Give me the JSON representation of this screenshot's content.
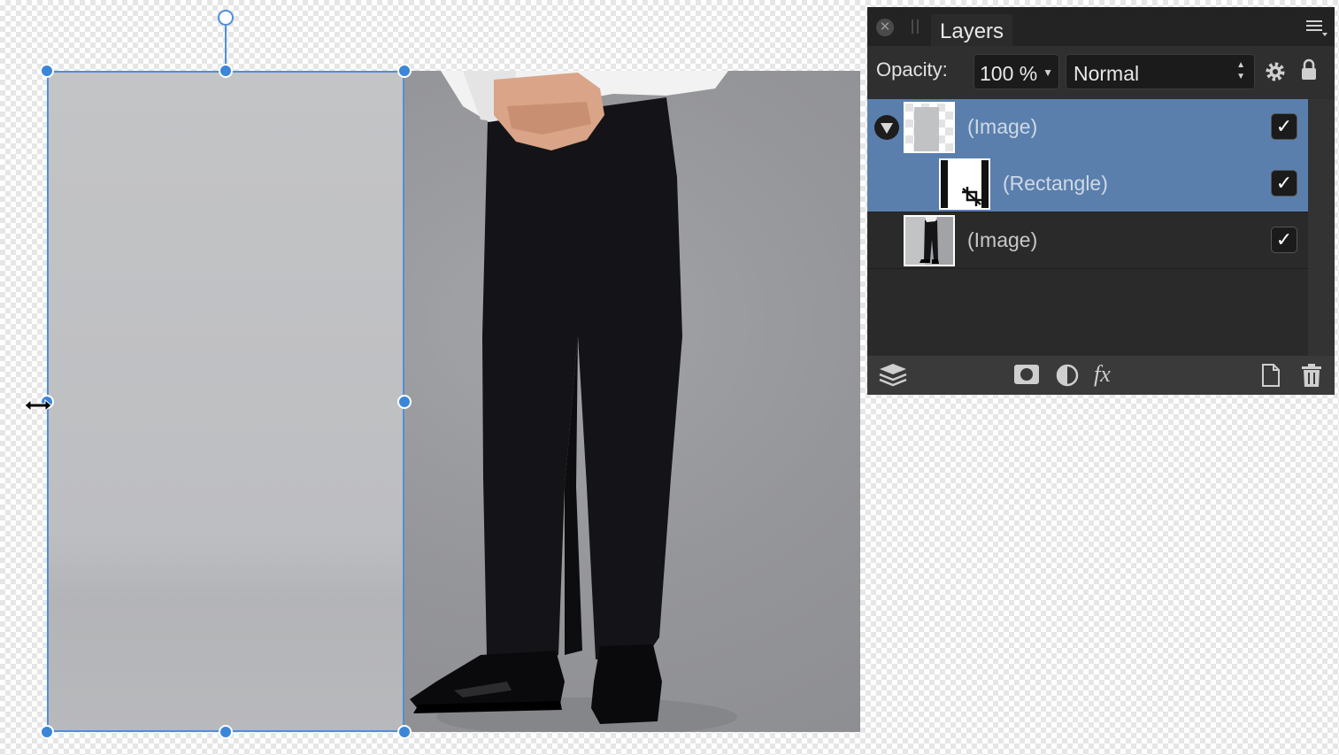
{
  "panel": {
    "title": "Layers",
    "opacity_label": "Opacity:",
    "opacity_value": "100 %",
    "blend_mode": "Normal"
  },
  "layers": [
    {
      "name": "(Image)",
      "selected": true,
      "visible": true
    },
    {
      "name": "(Rectangle)",
      "selected": true,
      "visible": true,
      "child": true
    },
    {
      "name": "(Image)",
      "selected": false,
      "visible": true
    }
  ],
  "icons": {
    "close": "close-icon",
    "menu": "panel-menu-icon",
    "settings": "gear-icon",
    "lock": "lock-icon",
    "layers": "layers-stack-icon",
    "mask": "mask-icon",
    "adjustment": "adjustment-icon",
    "fx": "fx",
    "new": "new-layer-icon",
    "delete": "trash-icon"
  },
  "colors": {
    "selection": "#4f8fd8",
    "selected_row": "#5a7fad",
    "panel_bg": "#2b2b2b"
  }
}
